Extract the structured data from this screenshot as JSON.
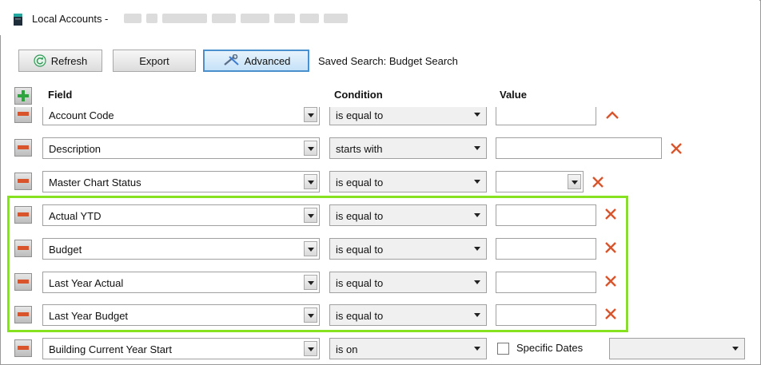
{
  "title": "Local Accounts -",
  "toolbar": {
    "refresh_label": "Refresh",
    "export_label": "Export",
    "advanced_label": "Advanced",
    "saved_search": "Saved Search: Budget Search"
  },
  "headers": {
    "field": "Field",
    "condition": "Condition",
    "value": "Value"
  },
  "rows": [
    {
      "field": "Account Code",
      "condition": "is equal to"
    },
    {
      "field": "Description",
      "condition": "starts with"
    },
    {
      "field": "Master Chart Status",
      "condition": "is equal to"
    },
    {
      "field": "Actual YTD",
      "condition": "is equal to"
    },
    {
      "field": "Budget",
      "condition": "is equal to"
    },
    {
      "field": "Last Year Actual",
      "condition": "is equal to"
    },
    {
      "field": "Last Year Budget",
      "condition": "is equal to"
    },
    {
      "field": "Building Current Year Start",
      "condition": "is on",
      "checkbox_label": "Specific Dates"
    }
  ],
  "colors": {
    "highlight": "#86e21f",
    "delete": "#d9542b",
    "add": "#2fa33d",
    "advanced_border": "#4a90cf"
  }
}
